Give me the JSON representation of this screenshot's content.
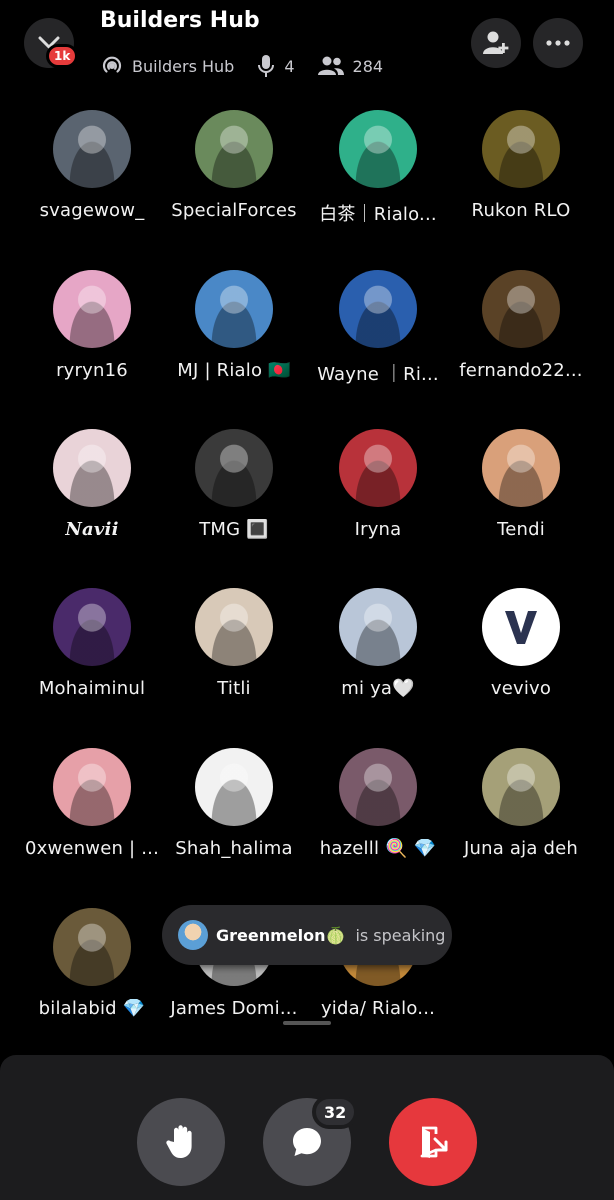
{
  "header": {
    "title": "Builders Hub",
    "notification_count": "1k",
    "server_name": "Builders Hub",
    "speaker_count": "4",
    "listener_count": "284"
  },
  "participants": [
    {
      "name": "svagewow_",
      "avatar_icon": "monster-avatar",
      "color": "#5a6470"
    },
    {
      "name": "SpecialForces",
      "avatar_icon": "man-avatar",
      "color": "#6a8a5c"
    },
    {
      "name": "白茶｜Rialo...",
      "avatar_icon": "skeleton-wizard-avatar",
      "color": "#2fb08a"
    },
    {
      "name": "Rukon RLO",
      "avatar_icon": "spiral-avatar",
      "color": "#6b5c22"
    },
    {
      "name": "ryryn16",
      "avatar_icon": "anime-girl-avatar",
      "color": "#e6a6c6"
    },
    {
      "name": "MJ | Rialo 🇧🇩",
      "avatar_icon": "cartoon-boy-avatar",
      "color": "#4a88c7"
    },
    {
      "name": "Wayne ｜Ri...",
      "avatar_icon": "cartoon-glasses-avatar",
      "color": "#2a5fae"
    },
    {
      "name": "fernando22...",
      "avatar_icon": "eagle-avatar",
      "color": "#5a4226"
    },
    {
      "name": "Navii",
      "avatar_icon": "anime-glasses-girl-avatar",
      "color": "#e9d3d8"
    },
    {
      "name": "TMG 🔳",
      "avatar_icon": "curly-hair-avatar",
      "color": "#3a3a3a"
    },
    {
      "name": "Iryna",
      "avatar_icon": "anime-red-avatar",
      "color": "#b8323a"
    },
    {
      "name": "Tendi",
      "avatar_icon": "flower-girl-avatar",
      "color": "#d9a07a"
    },
    {
      "name": "Mohaiminul",
      "avatar_icon": "silhouette-avatar",
      "color": "#4a2a6a"
    },
    {
      "name": "Titli",
      "avatar_icon": "curly-girl-avatar",
      "color": "#d8c9b8"
    },
    {
      "name": "mi ya🤍",
      "avatar_icon": "white-dress-avatar",
      "color": "#b9c6d8"
    },
    {
      "name": "vevivo",
      "avatar_icon": "letter-v-avatar",
      "color": "#ffffff"
    },
    {
      "name": "0xwenwen | ...",
      "avatar_icon": "cat-ears-avatar",
      "color": "#e6a0a8"
    },
    {
      "name": "Shah_halima",
      "avatar_icon": "pixel-penguin-avatar",
      "color": "#f2f2f2"
    },
    {
      "name": "hazelll 🍭 💎",
      "avatar_icon": "cartoon-girl-avatar",
      "color": "#7a5a6a"
    },
    {
      "name": "Juna aja deh",
      "avatar_icon": "bear-hood-avatar",
      "color": "#a5a078"
    },
    {
      "name": "bilalabid 💎",
      "avatar_icon": "cat-sunglasses-avatar",
      "color": "#6a5a3a"
    },
    {
      "name": "James Domi...",
      "avatar_icon": "sketch-avatar",
      "color": "#bdbdbd"
    },
    {
      "name": "yida/ Rialo...",
      "avatar_icon": "orange-avatar",
      "color": "#c48a3a"
    }
  ],
  "speaking_toast": {
    "speaker": "Greenmelon🍈",
    "status": "is speaking"
  },
  "controls": {
    "chat_count": "32"
  },
  "colors": {
    "background": "#000000",
    "leave_button": "#e6383d",
    "control_button": "#4b4b50",
    "badge": "#e63b3b"
  }
}
